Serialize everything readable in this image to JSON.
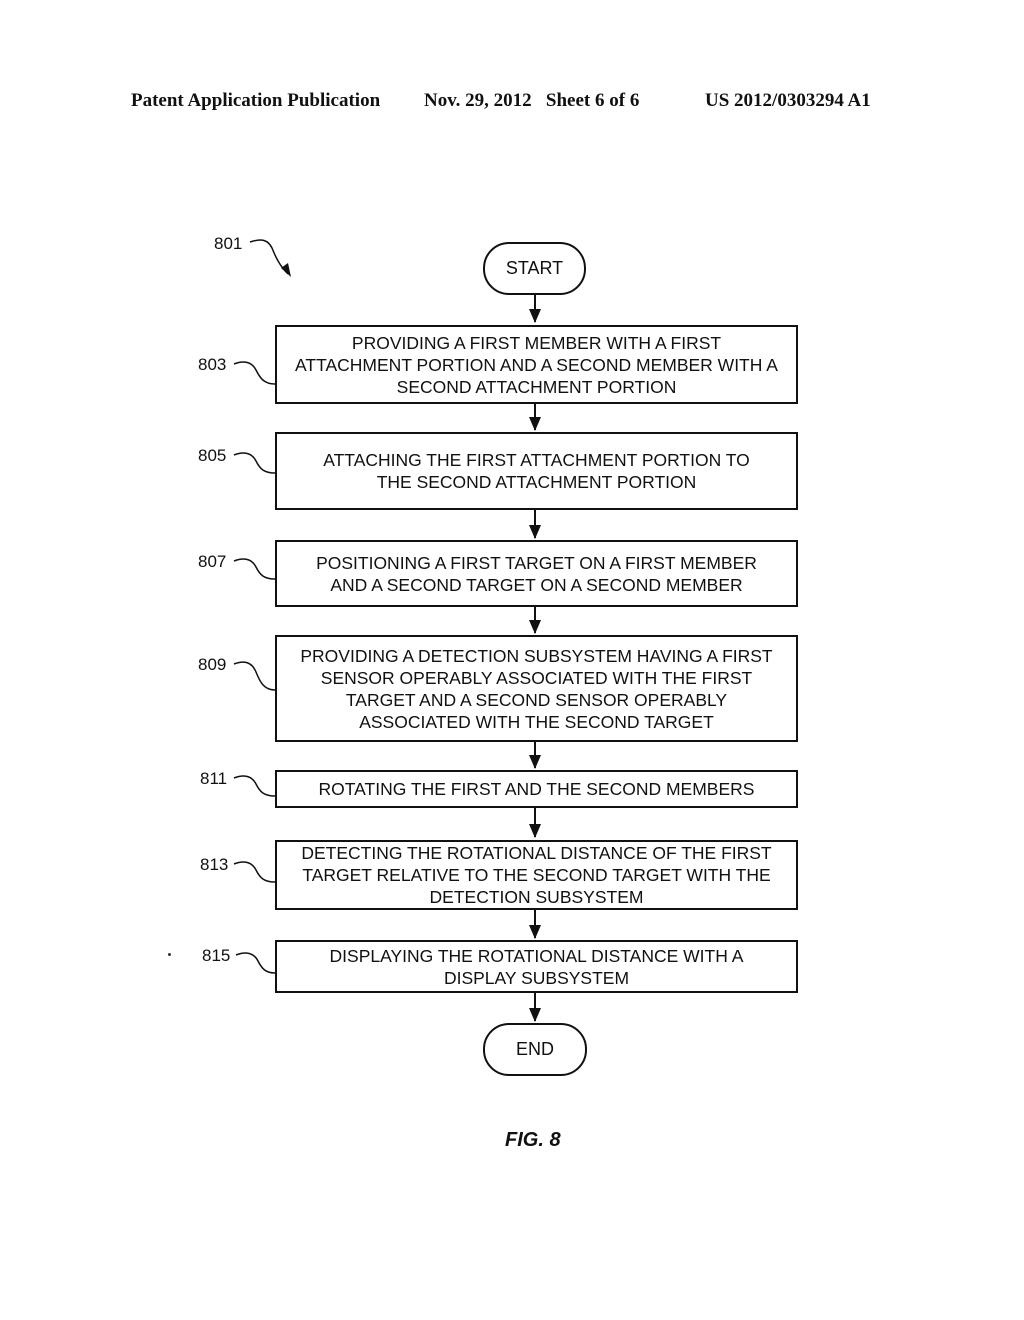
{
  "header": {
    "publication": "Patent Application Publication",
    "date_sheet": "Nov. 29, 2012   Sheet 6 of 6",
    "patent_number": "US 2012/0303294 A1"
  },
  "diagram": {
    "ref_number": "801",
    "start_label": "START",
    "end_label": "END",
    "steps": [
      {
        "ref": "803",
        "text": "PROVIDING A FIRST MEMBER WITH A FIRST ATTACHMENT PORTION AND A SECOND MEMBER WITH A SECOND ATTACHMENT PORTION"
      },
      {
        "ref": "805",
        "text": "ATTACHING THE FIRST ATTACHMENT PORTION TO THE SECOND ATTACHMENT PORTION"
      },
      {
        "ref": "807",
        "text": "POSITIONING A FIRST TARGET ON A FIRST MEMBER AND A SECOND TARGET ON A SECOND MEMBER"
      },
      {
        "ref": "809",
        "text": "PROVIDING A DETECTION SUBSYSTEM HAVING A FIRST SENSOR OPERABLY ASSOCIATED WITH THE FIRST TARGET AND A SECOND SENSOR OPERABLY ASSOCIATED WITH THE SECOND TARGET"
      },
      {
        "ref": "811",
        "text": "ROTATING THE FIRST AND THE SECOND MEMBERS"
      },
      {
        "ref": "813",
        "text": "DETECTING THE ROTATIONAL DISTANCE OF THE FIRST TARGET RELATIVE TO THE SECOND TARGET WITH THE DETECTION SUBSYSTEM"
      },
      {
        "ref": "815",
        "text": "DISPLAYING THE ROTATIONAL DISTANCE WITH A DISPLAY SUBSYSTEM"
      }
    ],
    "figure_caption": "FIG. 8"
  }
}
